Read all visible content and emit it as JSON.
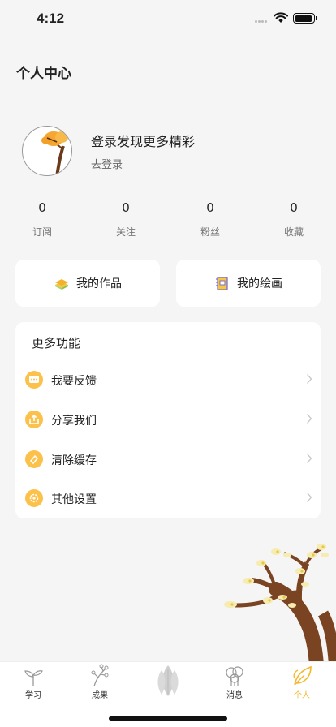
{
  "status": {
    "time": "4:12"
  },
  "header": {
    "title": "个人中心"
  },
  "profile": {
    "title": "登录发现更多精彩",
    "login_link": "去登录"
  },
  "stats": [
    {
      "value": "0",
      "label": "订阅"
    },
    {
      "value": "0",
      "label": "关注"
    },
    {
      "value": "0",
      "label": "粉丝"
    },
    {
      "value": "0",
      "label": "收藏"
    }
  ],
  "works": {
    "my_works": "我的作品",
    "my_drawings": "我的绘画"
  },
  "more": {
    "title": "更多功能",
    "items": [
      {
        "label": "我要反馈",
        "icon": "feedback-icon"
      },
      {
        "label": "分享我们",
        "icon": "share-icon"
      },
      {
        "label": "清除缓存",
        "icon": "clear-cache-icon"
      },
      {
        "label": "其他设置",
        "icon": "settings-icon"
      }
    ]
  },
  "tabs": [
    {
      "label": "学习",
      "icon": "sprout-icon"
    },
    {
      "label": "成果",
      "icon": "branch-icon"
    },
    {
      "label": "",
      "icon": "center-leaf-icon"
    },
    {
      "label": "消息",
      "icon": "trees-icon"
    },
    {
      "label": "个人",
      "icon": "leaf-icon",
      "active": true
    }
  ],
  "colors": {
    "accent": "#f4b82e",
    "menu_icon_bg": "#fcc14a",
    "background": "#f5f5f5"
  }
}
